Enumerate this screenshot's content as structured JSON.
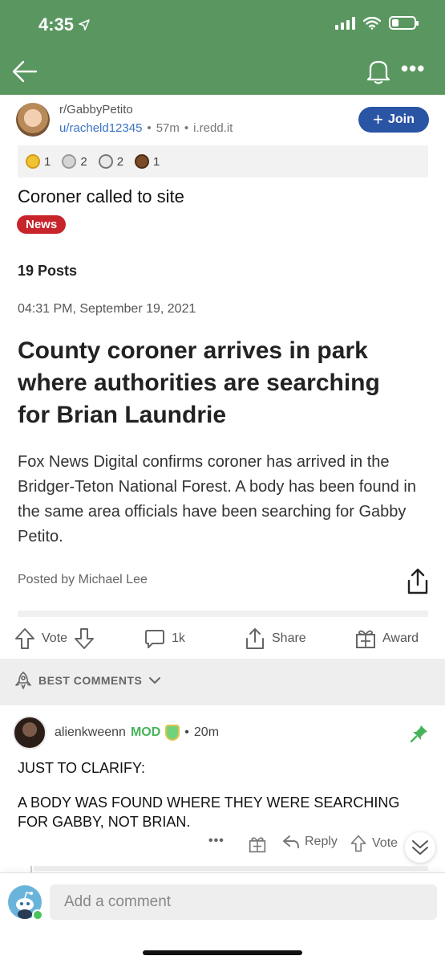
{
  "status_bar": {
    "time": "4:35"
  },
  "post": {
    "subreddit": "r/GabbyPetito",
    "username": "u/racheld12345",
    "age": "57m",
    "domain": "i.redd.it",
    "join_label": "Join",
    "awards": [
      {
        "icon": "gold-award-icon",
        "count": "1",
        "color": "#f1c232"
      },
      {
        "icon": "silver-award-icon",
        "count": "2",
        "color": "#b9b9b9"
      },
      {
        "icon": "coin-award-icon",
        "count": "2",
        "color": "#9e9e9e"
      },
      {
        "icon": "bear-award-icon",
        "count": "1",
        "color": "#7a4b28"
      }
    ],
    "title": "Coroner called to site",
    "flair": "News",
    "flair_color": "#c8242c"
  },
  "article_image": {
    "posts_count": "19 Posts",
    "date": "04:31 PM, September 19, 2021",
    "headline": "County coroner arrives in park where authorities are searching for Brian Laundrie",
    "body": "Fox News Digital confirms coroner has arrived in the Bridger-Teton National Forest.  A body has been found in the same area officials have been searching for Gabby Petito.",
    "posted_by": "Posted by Michael Lee"
  },
  "actions": {
    "vote_label": "Vote",
    "comments_count": "1k",
    "share_label": "Share",
    "award_label": "Award"
  },
  "comments_section": {
    "sort_label": "BEST COMMENTS"
  },
  "comment": {
    "username": "alienkweenn",
    "mod_label": "MOD",
    "age": "20m",
    "line1": "JUST TO CLARIFY:",
    "line2": "A BODY WAS FOUND WHERE THEY WERE SEARCHING FOR GABBY, NOT BRIAN.",
    "more_label": "•••",
    "reply_label": "Reply",
    "vote_label": "Vote"
  },
  "composer": {
    "placeholder": "Add a comment"
  },
  "colors": {
    "header_green": "#5a9760",
    "join_blue": "#2a54a4",
    "username_blue": "#3b74c5",
    "mod_green": "#46b55a"
  }
}
